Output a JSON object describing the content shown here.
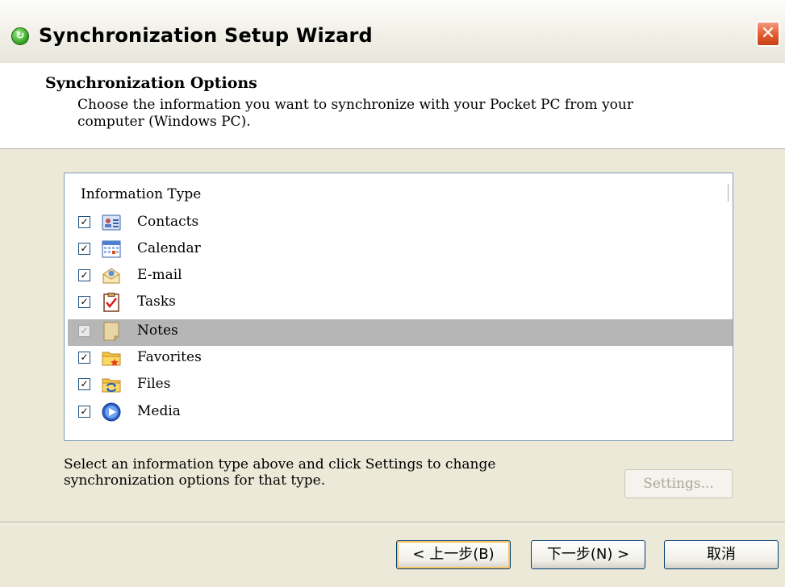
{
  "window": {
    "title": "Synchronization Setup Wizard",
    "close_glyph": "✕",
    "app_icon_glyph": "↻"
  },
  "header": {
    "title": "Synchronization Options",
    "subtitle": "Choose the information you want to synchronize with your Pocket PC from your computer (Windows PC)."
  },
  "list": {
    "column_header": "Information Type",
    "items": [
      {
        "label": "Contacts",
        "checked": true,
        "icon": "contacts-icon"
      },
      {
        "label": "Calendar",
        "checked": true,
        "icon": "calendar-icon"
      },
      {
        "label": "E-mail",
        "checked": true,
        "icon": "email-icon"
      },
      {
        "label": "Tasks",
        "checked": true,
        "icon": "tasks-icon"
      },
      {
        "label": "Notes",
        "checked": true,
        "icon": "notes-icon",
        "selected": true,
        "disabled": true
      },
      {
        "label": "Favorites",
        "checked": true,
        "icon": "favorites-icon"
      },
      {
        "label": "Files",
        "checked": true,
        "icon": "files-icon"
      },
      {
        "label": "Media",
        "checked": true,
        "icon": "media-icon"
      }
    ]
  },
  "info_text": "Select an information type above and click Settings to change synchronization options for that type.",
  "buttons": {
    "settings": "Settings...",
    "back": "< 上一步(B)",
    "next": "下一步(N) >",
    "cancel": "取消"
  },
  "colors": {
    "dialog_bg": "#ece9d8",
    "selection_bg": "#b6b6b6",
    "close_red": "#e25a2a"
  }
}
